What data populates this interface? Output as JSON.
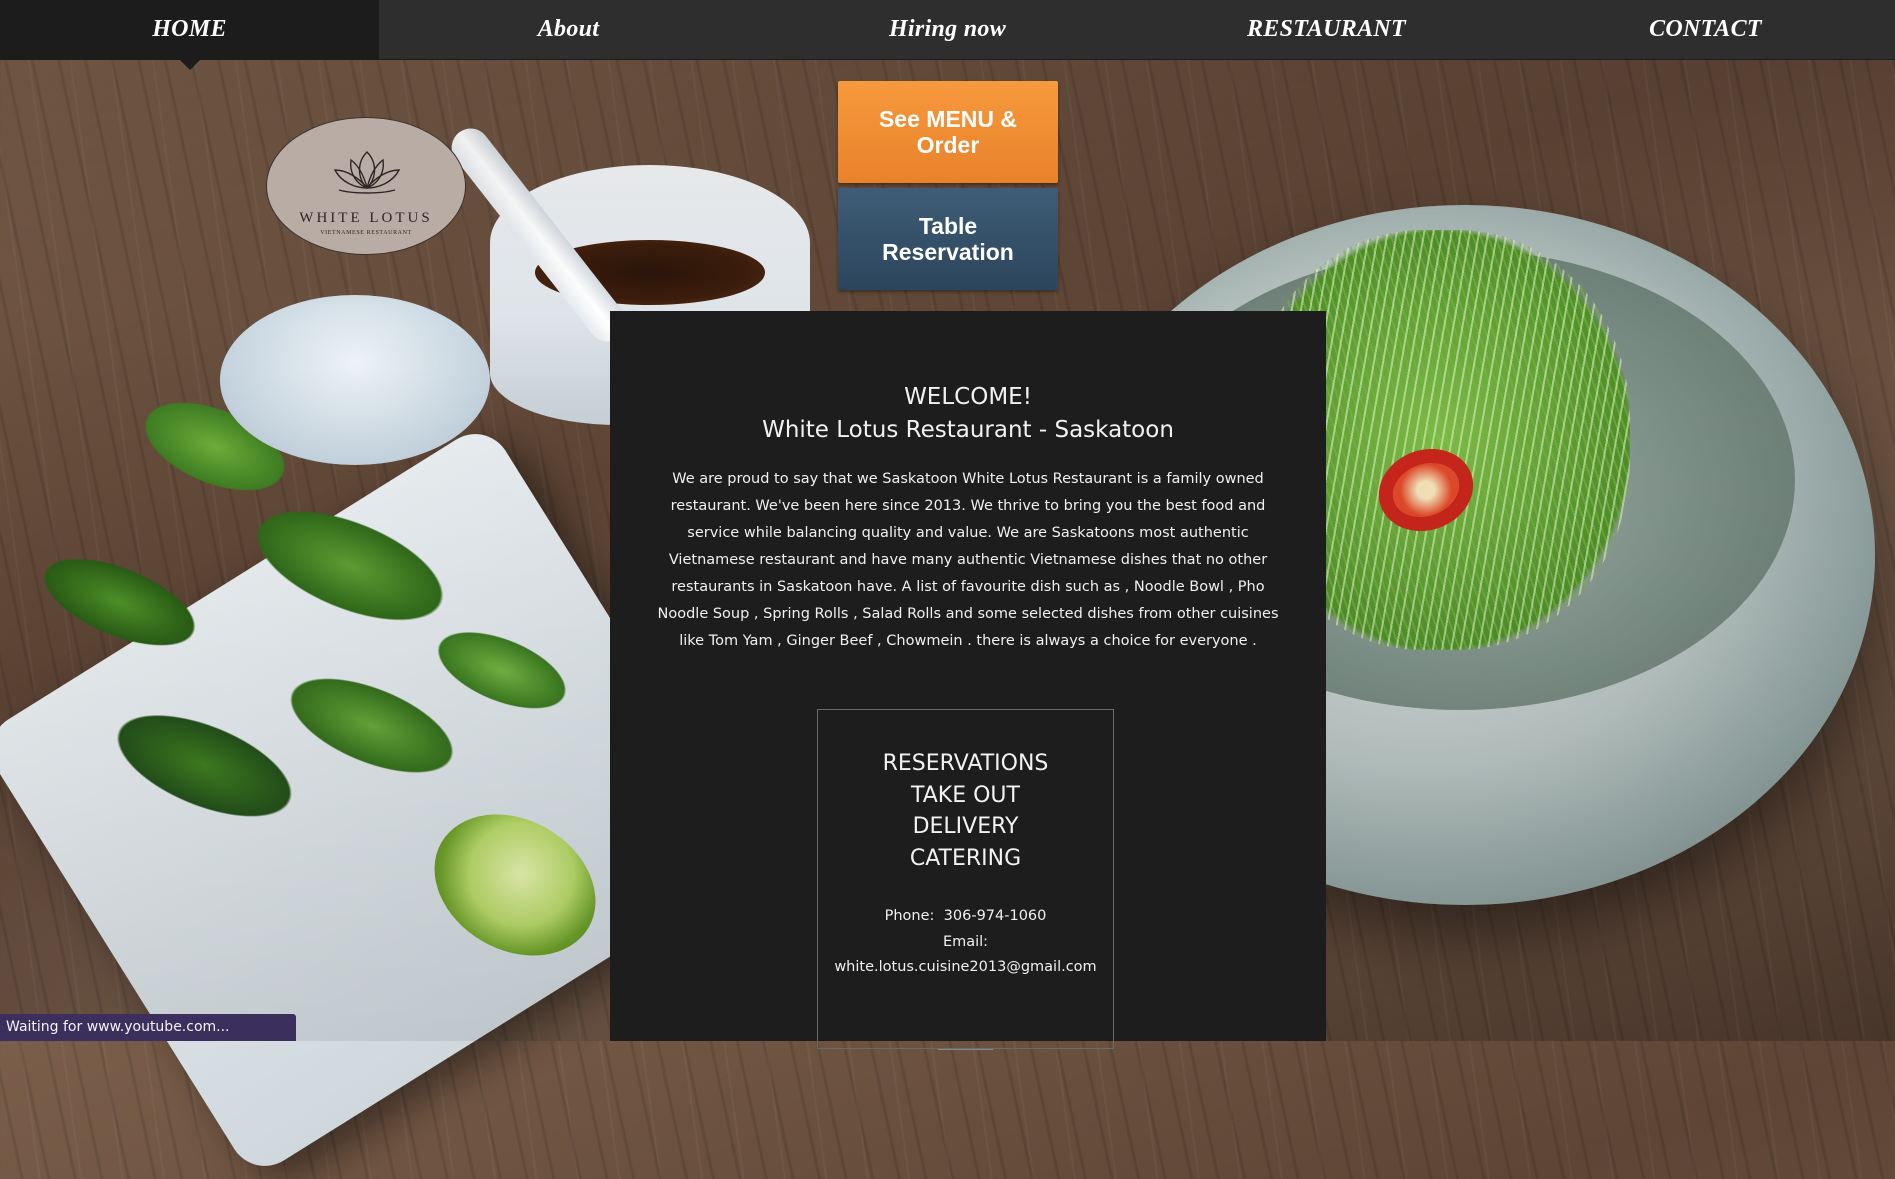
{
  "nav": {
    "items": [
      {
        "label": "HOME"
      },
      {
        "label": "About"
      },
      {
        "label": "Hiring now"
      },
      {
        "label": "RESTAURANT"
      },
      {
        "label": "CONTACT"
      }
    ],
    "active_index": 0
  },
  "logo": {
    "name": "WHITE LOTUS",
    "subtitle": "VIETNAMESE RESTAURANT",
    "icon": "lotus-flower-icon"
  },
  "buttons": {
    "menu_label": "See MENU & Order",
    "table_label": "Table Reservation"
  },
  "welcome": {
    "title": "WELCOME!",
    "subtitle": "White Lotus Restaurant - Saskatoon",
    "body": "We are proud to say that we Saskatoon White Lotus Restaurant is  a family owned restaurant. We've been here since 2013. We thrive to bring you the best food and service while balancing quality and value. We are Saskatoons most authentic Vietnamese restaurant and have many authentic Vietnamese dishes that no other restaurants in Saskatoon have.  A list of favourite dish such as , Noodle Bowl , Pho Noodle Soup , Spring Rolls , Salad Rolls and some selected dishes from other cuisines like Tom Yam , Ginger Beef , Chowmein . there is always a choice for everyone ."
  },
  "services": {
    "items": [
      "RESERVATIONS",
      "TAKE OUT",
      "DELIVERY",
      "CATERING"
    ],
    "phone_label": "Phone:",
    "phone": "306-974-1060",
    "email_label": "Email:",
    "email": "white.lotus.cuisine2013@gmail.com"
  },
  "status_bar": {
    "text": "Waiting for www.youtube.com..."
  },
  "colors": {
    "nav_bg": "#2e2e2e",
    "nav_active_bg": "#1c1c1c",
    "menu_button": "#f7993d",
    "table_button": "#34506a",
    "panel_bg": "#1d1d1d",
    "status_bg": "#3b2f5e"
  }
}
